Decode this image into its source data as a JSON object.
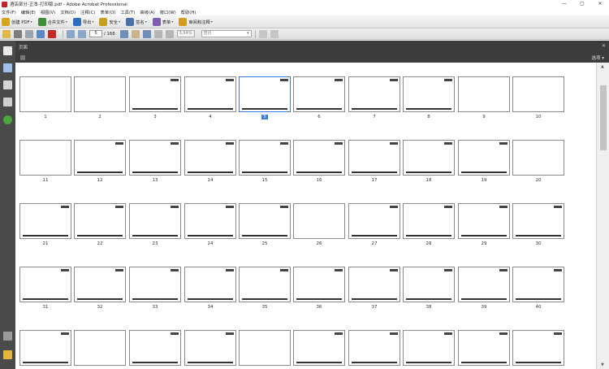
{
  "window": {
    "title": "酒店部分-正本-打印版.pdf - Adobe Acrobat Professional",
    "controls": [
      "—",
      "▢",
      "✕"
    ]
  },
  "menu": [
    "文件(F)",
    "编辑(E)",
    "视图(V)",
    "文档(D)",
    "注释(C)",
    "表单(O)",
    "工具(T)",
    "高级(A)",
    "窗口(W)",
    "帮助(H)"
  ],
  "toolbar": [
    {
      "label": "创建 PDF",
      "icon": "create-pdf-icon",
      "color": "#d4a51b"
    },
    {
      "label": "合并文件",
      "icon": "combine-icon",
      "color": "#3f8e3a"
    },
    {
      "label": "导出",
      "icon": "export-icon",
      "color": "#2d6fbf"
    },
    {
      "label": "安全",
      "icon": "lock-icon",
      "color": "#c3a020"
    },
    {
      "label": "签名",
      "icon": "pen-icon",
      "color": "#4d6fa8"
    },
    {
      "label": "表单",
      "icon": "form-icon",
      "color": "#7e5db0"
    },
    {
      "label": "审阅和注释",
      "icon": "comment-icon",
      "color": "#d49b21"
    }
  ],
  "nav": {
    "current_page": "5",
    "total_pages": "/ 168",
    "zoom": "3.54%",
    "find_placeholder": "查找"
  },
  "panel": {
    "title": "页面",
    "options": "选项 ▾",
    "close": "✕"
  },
  "scrollbar": {
    "up": "▲",
    "down": "▼"
  },
  "thumbnails": [
    {
      "n": "1",
      "style": "p-ocean"
    },
    {
      "n": "2",
      "style": "p-navy"
    },
    {
      "n": "3",
      "style": "p-photo1"
    },
    {
      "n": "4",
      "style": "p-photo2"
    },
    {
      "n": "5",
      "style": "p-photo2",
      "current": true
    },
    {
      "n": "6",
      "style": "p-photo3"
    },
    {
      "n": "7",
      "style": "p-photo3"
    },
    {
      "n": "8",
      "style": "p-photo1"
    },
    {
      "n": "9",
      "style": "p-navy"
    },
    {
      "n": "10",
      "style": "p-grey"
    },
    {
      "n": "11",
      "style": "p-map"
    },
    {
      "n": "12",
      "style": "p-color"
    },
    {
      "n": "13",
      "style": "p-plan"
    },
    {
      "n": "14",
      "style": "p-plan"
    },
    {
      "n": "15",
      "style": "p-plan"
    },
    {
      "n": "16",
      "style": "p-plan"
    },
    {
      "n": "17",
      "style": "p-color"
    },
    {
      "n": "18",
      "style": "p-color"
    },
    {
      "n": "19",
      "style": "p-color"
    },
    {
      "n": "20",
      "style": "p-grey"
    },
    {
      "n": "21",
      "style": "p-white"
    },
    {
      "n": "22",
      "style": "p-white"
    },
    {
      "n": "23",
      "style": "p-white"
    },
    {
      "n": "24",
      "style": "p-color"
    },
    {
      "n": "25",
      "style": "p-plan"
    },
    {
      "n": "26",
      "style": "p-grey"
    },
    {
      "n": "27",
      "style": "p-plan"
    },
    {
      "n": "28",
      "style": "p-dark"
    },
    {
      "n": "29",
      "style": "p-color"
    },
    {
      "n": "30",
      "style": "p-plan"
    },
    {
      "n": "31",
      "style": "p-color"
    },
    {
      "n": "32",
      "style": "p-plan"
    },
    {
      "n": "33",
      "style": "p-plan"
    },
    {
      "n": "34",
      "style": "p-color"
    },
    {
      "n": "35",
      "style": "p-plan"
    },
    {
      "n": "36",
      "style": "p-plan"
    },
    {
      "n": "37",
      "style": "p-plan"
    },
    {
      "n": "38",
      "style": "p-dark"
    },
    {
      "n": "39",
      "style": "p-color"
    },
    {
      "n": "40",
      "style": "p-color"
    },
    {
      "n": "",
      "style": "p-color"
    },
    {
      "n": "",
      "style": "p-grey"
    },
    {
      "n": "",
      "style": "p-plan"
    },
    {
      "n": "",
      "style": "p-photo1"
    },
    {
      "n": "",
      "style": "p-grey"
    },
    {
      "n": "",
      "style": "p-color"
    },
    {
      "n": "",
      "style": "p-photo2"
    },
    {
      "n": "",
      "style": "p-white"
    },
    {
      "n": "",
      "style": "p-photo3"
    },
    {
      "n": "",
      "style": "p-photo1"
    }
  ]
}
